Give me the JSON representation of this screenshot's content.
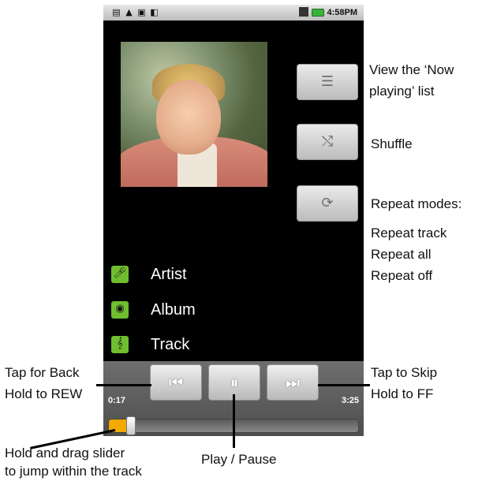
{
  "status_bar": {
    "time": "4:58PM",
    "left_icons": [
      "document-icon",
      "warning-icon",
      "usb-icon",
      "media-icon"
    ],
    "right_icons": [
      "signal-icon",
      "battery-icon"
    ]
  },
  "album_art": {
    "description_icon": "album-art-photo"
  },
  "side_buttons": [
    {
      "name": "now-playing-list-button",
      "icon": "list-icon",
      "glyph": "☰"
    },
    {
      "name": "shuffle-button",
      "icon": "shuffle-icon",
      "glyph": "⤭"
    },
    {
      "name": "repeat-button",
      "icon": "repeat-icon",
      "glyph": "⟳"
    }
  ],
  "metadata": {
    "artist": "Artist",
    "album": "Album",
    "track": "Track"
  },
  "controls": {
    "prev_glyph": "⏮",
    "pause_glyph": "⏸",
    "next_glyph": "⏭",
    "elapsed": "0:17",
    "duration": "3:25",
    "progress_fraction": 0.083
  },
  "annotations": {
    "now_playing_1": "View the ‘Now",
    "now_playing_2": "playing’ list",
    "shuffle": "Shuffle",
    "repeat_title": "Repeat modes:",
    "repeat_track": "Repeat track",
    "repeat_all": "Repeat all",
    "repeat_off": "Repeat off",
    "back_1": "Tap for Back",
    "back_2": "Hold to REW",
    "skip_1": "Tap to Skip",
    "skip_2": "Hold to FF",
    "slider_1": "Hold and drag slider",
    "slider_2": "to jump within the track",
    "play_pause": "Play / Pause"
  },
  "colors": {
    "accent_green": "#6fbe2f",
    "progress": "#f2a900",
    "background": "#000000"
  }
}
